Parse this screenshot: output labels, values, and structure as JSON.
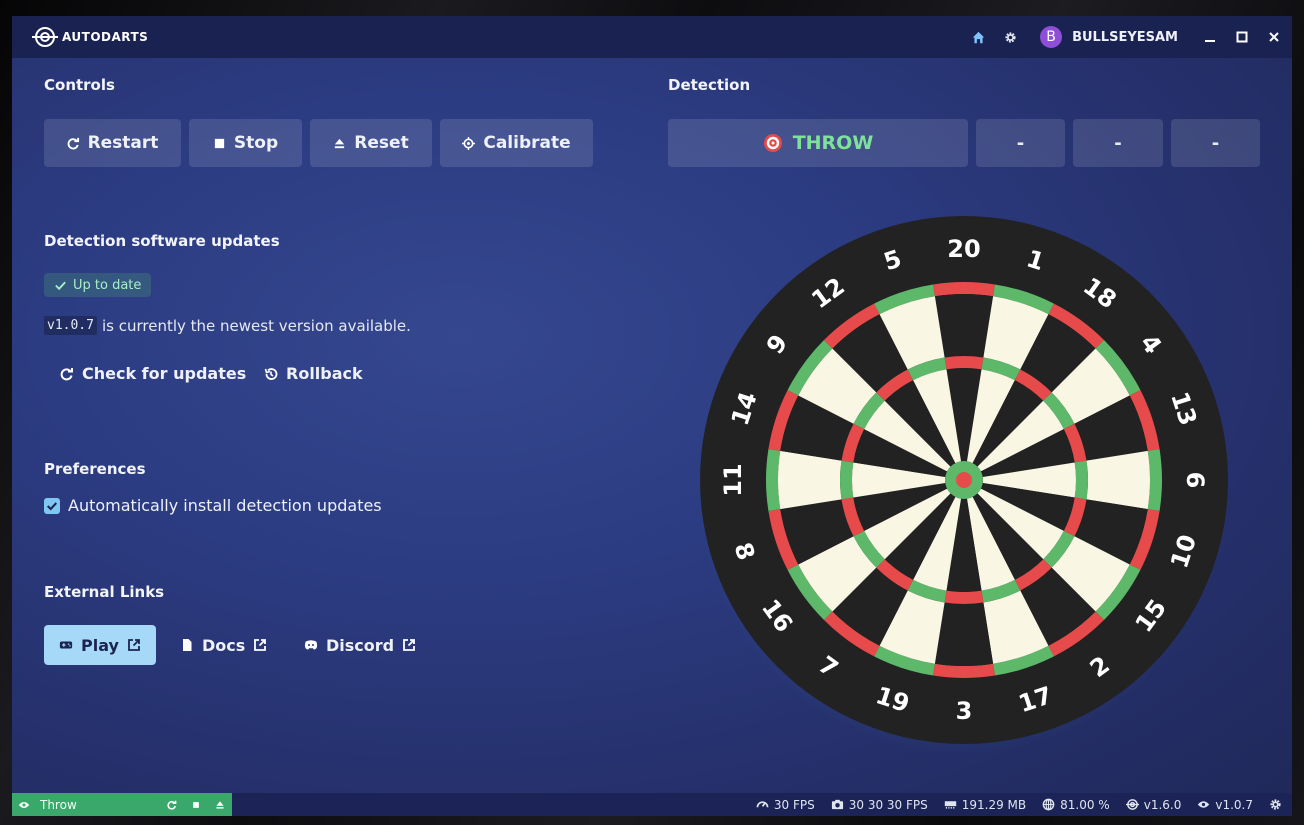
{
  "app": {
    "title": "AUTODARTS",
    "username": "BULLSEYESAM",
    "avatar_letter": "B"
  },
  "controls": {
    "heading": "Controls",
    "restart": "Restart",
    "stop": "Stop",
    "reset": "Reset",
    "calibrate": "Calibrate"
  },
  "updates": {
    "heading": "Detection software updates",
    "status": "Up to date",
    "version": "v1.0.7",
    "version_text": "is currently the newest version available.",
    "check": "Check for updates",
    "rollback": "Rollback"
  },
  "preferences": {
    "heading": "Preferences",
    "auto_install": "Automatically install detection updates",
    "auto_install_checked": true
  },
  "links": {
    "heading": "External Links",
    "play": "Play",
    "docs": "Docs",
    "discord": "Discord"
  },
  "detection": {
    "heading": "Detection",
    "throw_label": "THROW",
    "slots": [
      "-",
      "-",
      "-"
    ]
  },
  "board": {
    "numbers": [
      "20",
      "1",
      "18",
      "4",
      "13",
      "6",
      "10",
      "15",
      "2",
      "17",
      "3",
      "19",
      "7",
      "16",
      "8",
      "11",
      "14",
      "9",
      "12",
      "5"
    ],
    "colors": {
      "black": "#222222",
      "cream": "#f9f6e4",
      "red": "#e64a4a",
      "green": "#5db86a"
    }
  },
  "status": {
    "mode": "Throw",
    "fps": "30 FPS",
    "camera_fps": "30 30 30 FPS",
    "memory": "191.29 MB",
    "cpu": "81.00 %",
    "app_version": "v1.6.0",
    "detection_version": "v1.0.7"
  }
}
